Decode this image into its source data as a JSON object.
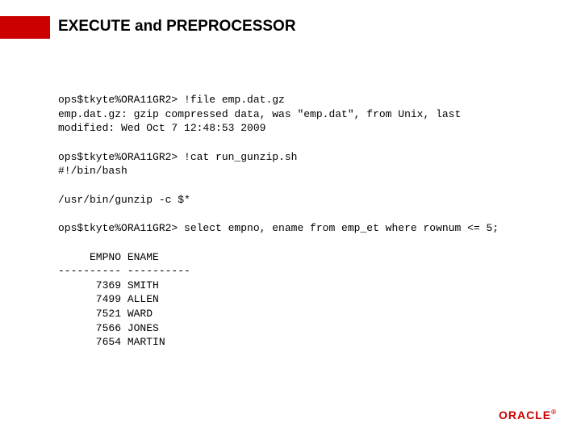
{
  "title": "EXECUTE and PREPROCESSOR",
  "block1": {
    "line1": "ops$tkyte%ORA11GR2> !file emp.dat.gz",
    "line2": "emp.dat.gz: gzip compressed data, was \"emp.dat\", from Unix, last",
    "line3": "  modified: Wed Oct  7 12:48:53 2009"
  },
  "block2": {
    "line1": "ops$tkyte%ORA11GR2> !cat run_gunzip.sh",
    "line2": "#!/bin/bash"
  },
  "block3": {
    "line1": "/usr/bin/gunzip -c $*"
  },
  "block4": {
    "line1": "ops$tkyte%ORA11GR2> select empno, ename from emp_et where rownum <= 5;"
  },
  "table": {
    "header": "     EMPNO ENAME",
    "sep": "---------- ----------",
    "rows": [
      "      7369 SMITH",
      "      7499 ALLEN",
      "      7521 WARD",
      "      7566 JONES",
      "      7654 MARTIN"
    ]
  },
  "logo": "ORACLE",
  "reg": "®"
}
